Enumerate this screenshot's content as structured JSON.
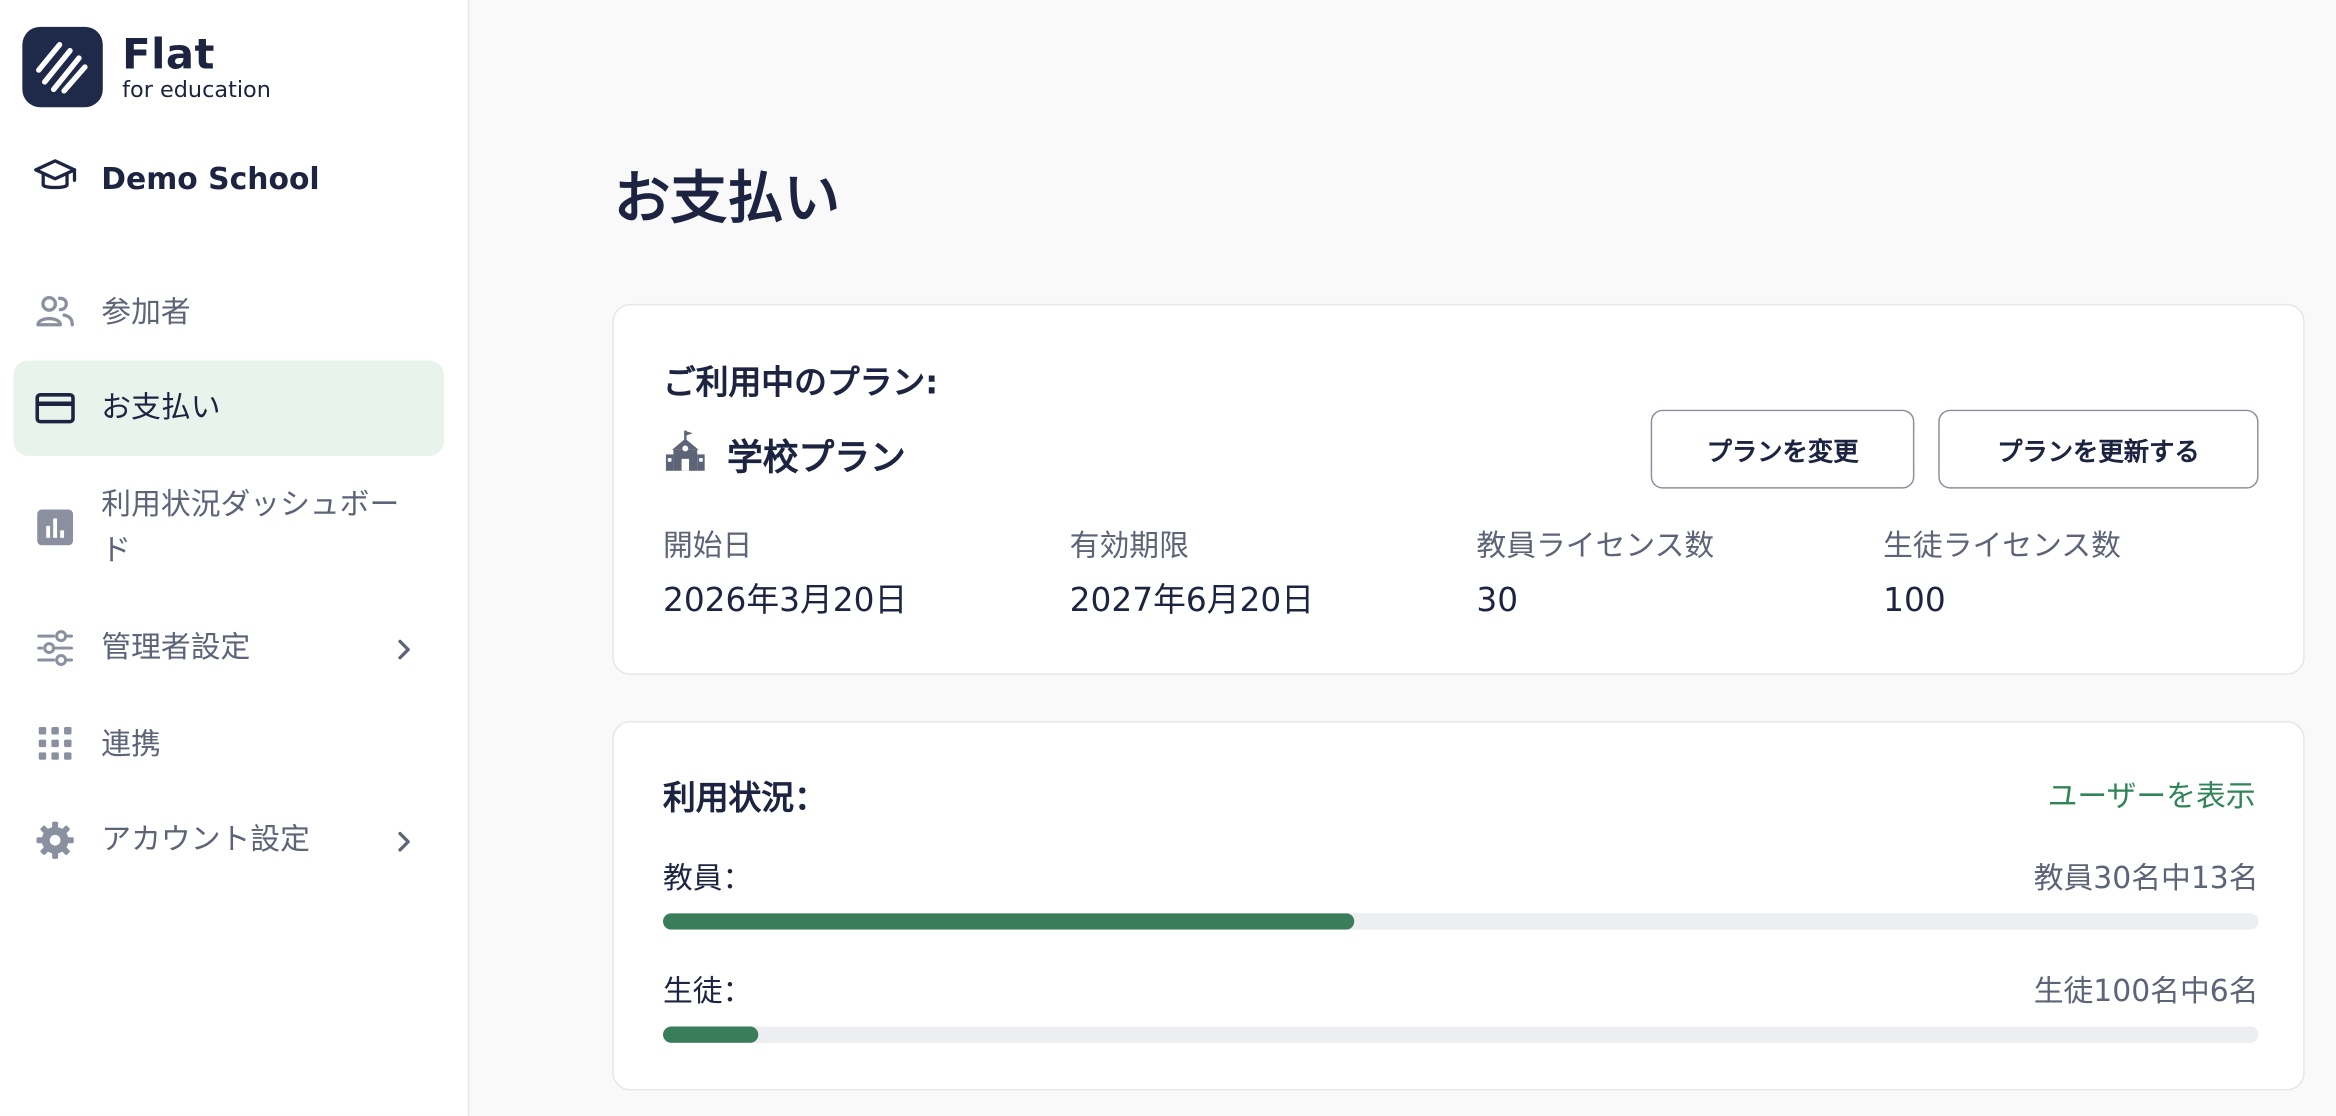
{
  "brand": {
    "name": "Flat",
    "subtitle": "for education"
  },
  "school": {
    "name": "Demo School",
    "icon": "graduation-cap-icon"
  },
  "sidebar": {
    "items": [
      {
        "label": "参加者",
        "icon": "people-icon",
        "active": false
      },
      {
        "label": "お支払い",
        "icon": "credit-card-icon",
        "active": true
      },
      {
        "label": "利用状況ダッシュボード",
        "icon": "bar-chart-icon",
        "active": false
      },
      {
        "label": "管理者設定",
        "icon": "sliders-icon",
        "active": false,
        "chevron": true
      },
      {
        "label": "連携",
        "icon": "grid-icon",
        "active": false
      },
      {
        "label": "アカウント設定",
        "icon": "gear-icon",
        "active": false,
        "chevron": true
      }
    ]
  },
  "page": {
    "title": "お支払い"
  },
  "plan": {
    "heading": "ご利用中のプラン:",
    "name": "学校プラン",
    "icon": "school-building-icon",
    "change_button": "プランを変更",
    "renew_button": "プランを更新する",
    "stats": [
      {
        "label": "開始日",
        "value": "2026年3月20日"
      },
      {
        "label": "有効期限",
        "value": "2027年6月20日"
      },
      {
        "label": "教員ライセンス数",
        "value": "30"
      },
      {
        "label": "生徒ライセンス数",
        "value": "100"
      }
    ]
  },
  "usage": {
    "heading": "利用状況：",
    "link": "ユーザーを表示",
    "teachers": {
      "label": "教員：",
      "count": "教員30名中13名",
      "used": 13,
      "total": 30
    },
    "students": {
      "label": "生徒：",
      "count": "生徒100名中6名",
      "used": 6,
      "total": 100
    }
  },
  "colors": {
    "accent": "#3a7d5b",
    "link": "#2f8458",
    "active_bg": "#e8f3ec",
    "navy": "#1c2441"
  }
}
